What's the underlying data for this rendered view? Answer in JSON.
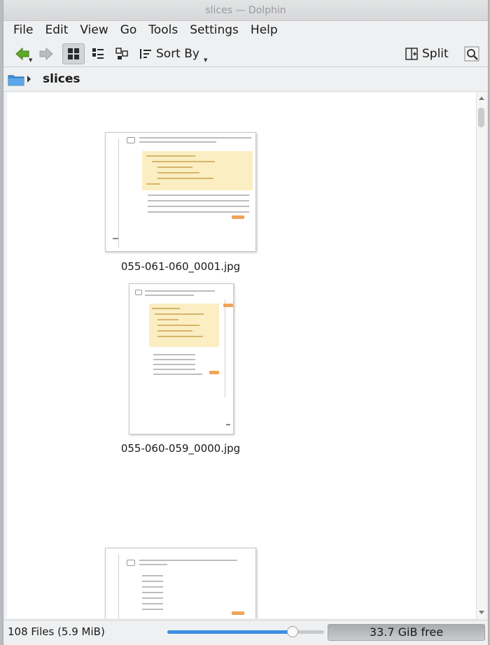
{
  "window": {
    "title": "slices — Dolphin"
  },
  "menubar": {
    "items": [
      "File",
      "Edit",
      "View",
      "Go",
      "Tools",
      "Settings",
      "Help"
    ]
  },
  "toolbar": {
    "back_icon": "arrow-left-icon",
    "forward_icon": "arrow-right-icon",
    "views": [
      "icons-view",
      "compact-view",
      "details-view"
    ],
    "active_view": "icons-view",
    "sort_label": "Sort By",
    "split_label": "Split",
    "search_icon": "search-icon"
  },
  "location": {
    "folder_icon": "folder-icon",
    "path": "slices"
  },
  "files": [
    {
      "name": "055-061-060_0001.jpg"
    },
    {
      "name": "055-060-059_0000.jpg"
    },
    {
      "name": ""
    }
  ],
  "status": {
    "summary": "108 Files (5.9 MiB)",
    "zoom_fraction": 0.78,
    "free_space": "33.7 GiB free"
  },
  "colors": {
    "accent": "#3d8ee0",
    "code_bg": "#fbeec3",
    "orange": "#f0a45a"
  }
}
